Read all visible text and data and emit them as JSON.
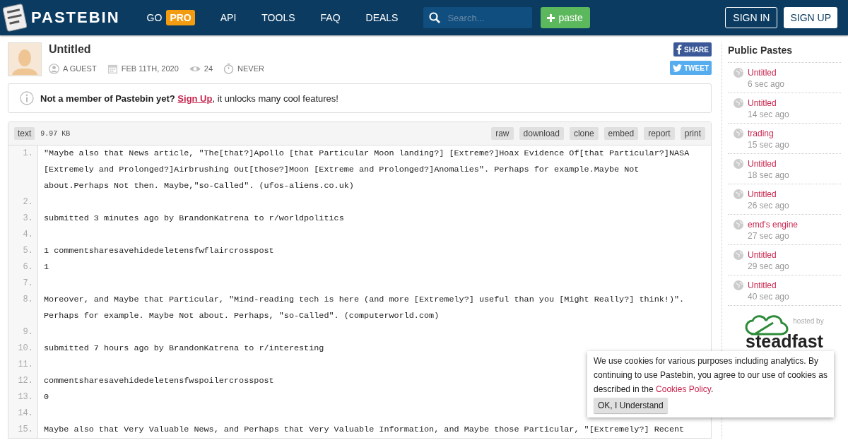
{
  "header": {
    "logo": "PASTEBIN",
    "nav": [
      {
        "label": "GO",
        "badge": "PRO"
      },
      {
        "label": "API"
      },
      {
        "label": "TOOLS"
      },
      {
        "label": "FAQ"
      },
      {
        "label": "DEALS"
      }
    ],
    "search": {
      "placeholder": "Search..."
    },
    "paste_button": "paste",
    "sign_in": "SIGN IN",
    "sign_up": "SIGN UP"
  },
  "paste": {
    "title": "Untitled",
    "author": "A GUEST",
    "date": "FEB 11TH, 2020",
    "views": "24",
    "expires": "NEVER",
    "share": "SHARE",
    "tweet": "TWEET"
  },
  "notice": {
    "before": "Not a member of Pastebin yet?",
    "link": "Sign Up",
    "after": ", it unlocks many cool features!"
  },
  "code": {
    "syntax": "text",
    "size": "9.97 KB",
    "actions": [
      "raw",
      "download",
      "clone",
      "embed",
      "report",
      "print"
    ],
    "lines": [
      {
        "n": "1.",
        "text": "\"Maybe also that News article, \"The[that?]Apollo [that Particular Moon landing?] [Extreme?]Hoax Evidence Of[that Particular?]NASA [Extremely and Prolonged?]Airbrushing Out[those?]Moon [Extreme and Prolonged?]Anomalies\". Perhaps for example.Maybe Not about.Perhaps Not then. Maybe,\"so-Called\". (ufos-aliens.co.uk)"
      },
      {
        "n": "2."
      },
      {
        "n": "3.",
        "text": "submitted 3 minutes ago by BrandonKatrena to r/worldpolitics"
      },
      {
        "n": "4."
      },
      {
        "n": "5.",
        "text": "1 commentsharesavehidedeletensfwflaircrosspost"
      },
      {
        "n": "6.",
        "text": "1"
      },
      {
        "n": "7."
      },
      {
        "n": "8.",
        "text": "Moreover, and Maybe that Particular, \"Mind-reading tech is here (and more [Extremely?] useful than you [Might Really?] think!)\". Perhaps for example. Maybe Not about. Perhaps, \"so-Called\". (computerworld.com)"
      },
      {
        "n": "9."
      },
      {
        "n": "10.",
        "text": "submitted 7 hours ago by BrandonKatrena to r/interesting"
      },
      {
        "n": "11."
      },
      {
        "n": "12.",
        "text": "commentsharesavehidedeletensfwspoilercrosspost"
      },
      {
        "n": "13.",
        "text": "0"
      },
      {
        "n": "14."
      },
      {
        "n": "15.",
        "text": "Maybe also that Very Valuable News, and Perhaps that Very Valuable Information, and Maybe those Particular, \"[Extremely?] Recent"
      }
    ]
  },
  "sidebar": {
    "title": "Public Pastes",
    "items": [
      {
        "title": "Untitled",
        "time": "6 sec ago"
      },
      {
        "title": "Untitled",
        "time": "14 sec ago"
      },
      {
        "title": "trading",
        "time": "15 sec ago"
      },
      {
        "title": "Untitled",
        "time": "18 sec ago"
      },
      {
        "title": "Untitled",
        "time": "26 sec ago"
      },
      {
        "title": "emd's engine",
        "time": "27 sec ago"
      },
      {
        "title": "Untitled",
        "time": "29 sec ago"
      },
      {
        "title": "Untitled",
        "time": "40 sec ago"
      }
    ],
    "sponsor_label": "hosted by",
    "sponsor": "steadfast"
  },
  "cookie": {
    "text": "We use cookies for various purposes including analytics. By continuing to use Pastebin, you agree to our use of cookies as described in the",
    "link": "Cookies Policy",
    "after": ".",
    "button": "OK, I Understand"
  }
}
